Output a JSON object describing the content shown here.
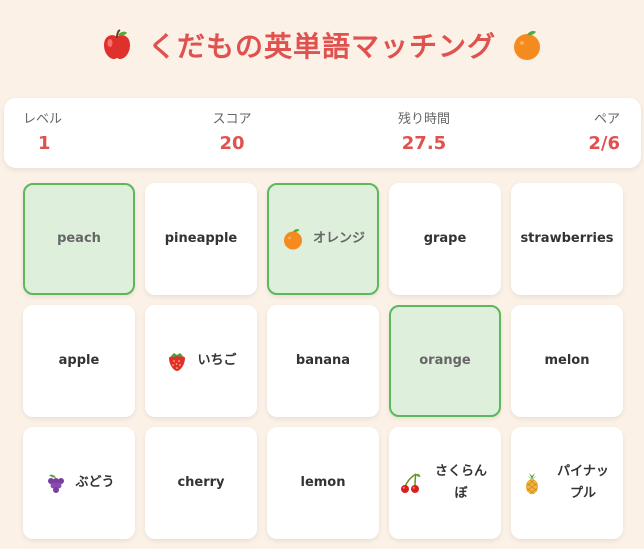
{
  "title": "くだもの英単語マッチング",
  "title_icons": [
    "apple-icon",
    "orange-icon"
  ],
  "stats": {
    "level_label": "レベル",
    "level": "1",
    "score_label": "スコア",
    "score": "20",
    "time_label": "残り時間",
    "time": "27.5",
    "pair_label": "ペア",
    "pairs": "2/6"
  },
  "colors": {
    "accent": "#e0524f",
    "background": "#fbf1e6",
    "matched_bg": "#deefdc",
    "matched_border": "#5cb85c"
  },
  "cards": [
    {
      "text": "peach",
      "icon": null,
      "matched": true
    },
    {
      "text": "pineapple",
      "icon": null,
      "matched": false
    },
    {
      "text": "オレンジ",
      "icon": "orange-icon",
      "matched": true
    },
    {
      "text": "grape",
      "icon": null,
      "matched": false
    },
    {
      "text": "strawberries",
      "icon": null,
      "matched": false
    },
    {
      "text": "apple",
      "icon": null,
      "matched": false
    },
    {
      "text": "いちご",
      "icon": "strawberry-icon",
      "matched": false
    },
    {
      "text": "banana",
      "icon": null,
      "matched": false
    },
    {
      "text": "orange",
      "icon": null,
      "matched": true
    },
    {
      "text": "melon",
      "icon": null,
      "matched": false
    },
    {
      "text": "ぶどう",
      "icon": "grapes-icon",
      "matched": false
    },
    {
      "text": "cherry",
      "icon": null,
      "matched": false
    },
    {
      "text": "lemon",
      "icon": null,
      "matched": false
    },
    {
      "text": "さくらんぼ",
      "icon": "cherries-icon",
      "matched": false
    },
    {
      "text": "パイナップル",
      "icon": "pineapple-icon",
      "matched": false
    }
  ]
}
